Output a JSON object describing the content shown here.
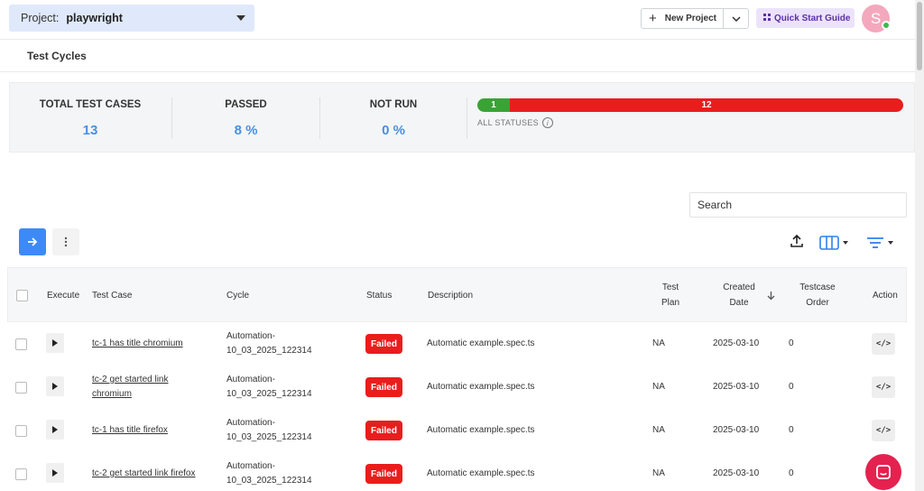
{
  "header": {
    "project_label": "Project:",
    "project_value": "playwright",
    "new_project_label": "New Project",
    "quick_start_label": "Quick Start Guide",
    "avatar_initial": "S"
  },
  "subheader": {
    "title": "Test Cycles"
  },
  "stats": {
    "total": {
      "label": "TOTAL TEST CASES",
      "value": "13"
    },
    "passed": {
      "label": "PASSED",
      "value": "8 %"
    },
    "not_run": {
      "label": "NOT RUN",
      "value": "0 %"
    },
    "status_bar": {
      "passed_count": "1",
      "failed_count": "12",
      "passed_color": "#3aa335",
      "failed_color": "#ea1d1d",
      "caption": "ALL STATUSES"
    }
  },
  "search": {
    "placeholder": "Search"
  },
  "table": {
    "headers": {
      "execute": "Execute",
      "test_case": "Test Case",
      "cycle": "Cycle",
      "status": "Status",
      "description": "Description",
      "test_plan_1": "Test",
      "test_plan_2": "Plan",
      "created_1": "Created",
      "created_2": "Date",
      "order_1": "Testcase",
      "order_2": "Order",
      "action": "Action"
    },
    "rows": [
      {
        "test_case_1": "tc-1 has title chromium",
        "test_case_2": "",
        "cycle_1": "Automation-",
        "cycle_2": "10_03_2025_122314",
        "status": "Failed",
        "description": "Automatic example.spec.ts",
        "test_plan": "NA",
        "created": "2025-03-10",
        "order": "0"
      },
      {
        "test_case_1": "tc-2 get started link",
        "test_case_2": "chromium",
        "cycle_1": "Automation-",
        "cycle_2": "10_03_2025_122314",
        "status": "Failed",
        "description": "Automatic example.spec.ts",
        "test_plan": "NA",
        "created": "2025-03-10",
        "order": "0"
      },
      {
        "test_case_1": "tc-1 has title firefox",
        "test_case_2": "",
        "cycle_1": "Automation-",
        "cycle_2": "10_03_2025_122314",
        "status": "Failed",
        "description": "Automatic example.spec.ts",
        "test_plan": "NA",
        "created": "2025-03-10",
        "order": "0"
      },
      {
        "test_case_1": "tc-2 get started link firefox",
        "test_case_2": "",
        "cycle_1": "Automation-",
        "cycle_2": "10_03_2025_122314",
        "status": "Failed",
        "description": "Automatic example.spec.ts",
        "test_plan": "NA",
        "created": "2025-03-10",
        "order": "0"
      }
    ],
    "status_color": "#ea1d1d"
  },
  "icons": {
    "go": "arrow-right-icon",
    "more": "more-vertical-icon",
    "upload": "upload-icon",
    "columns": "columns-icon",
    "filter": "filter-icon",
    "code": "code-icon",
    "chat": "chat-icon"
  }
}
